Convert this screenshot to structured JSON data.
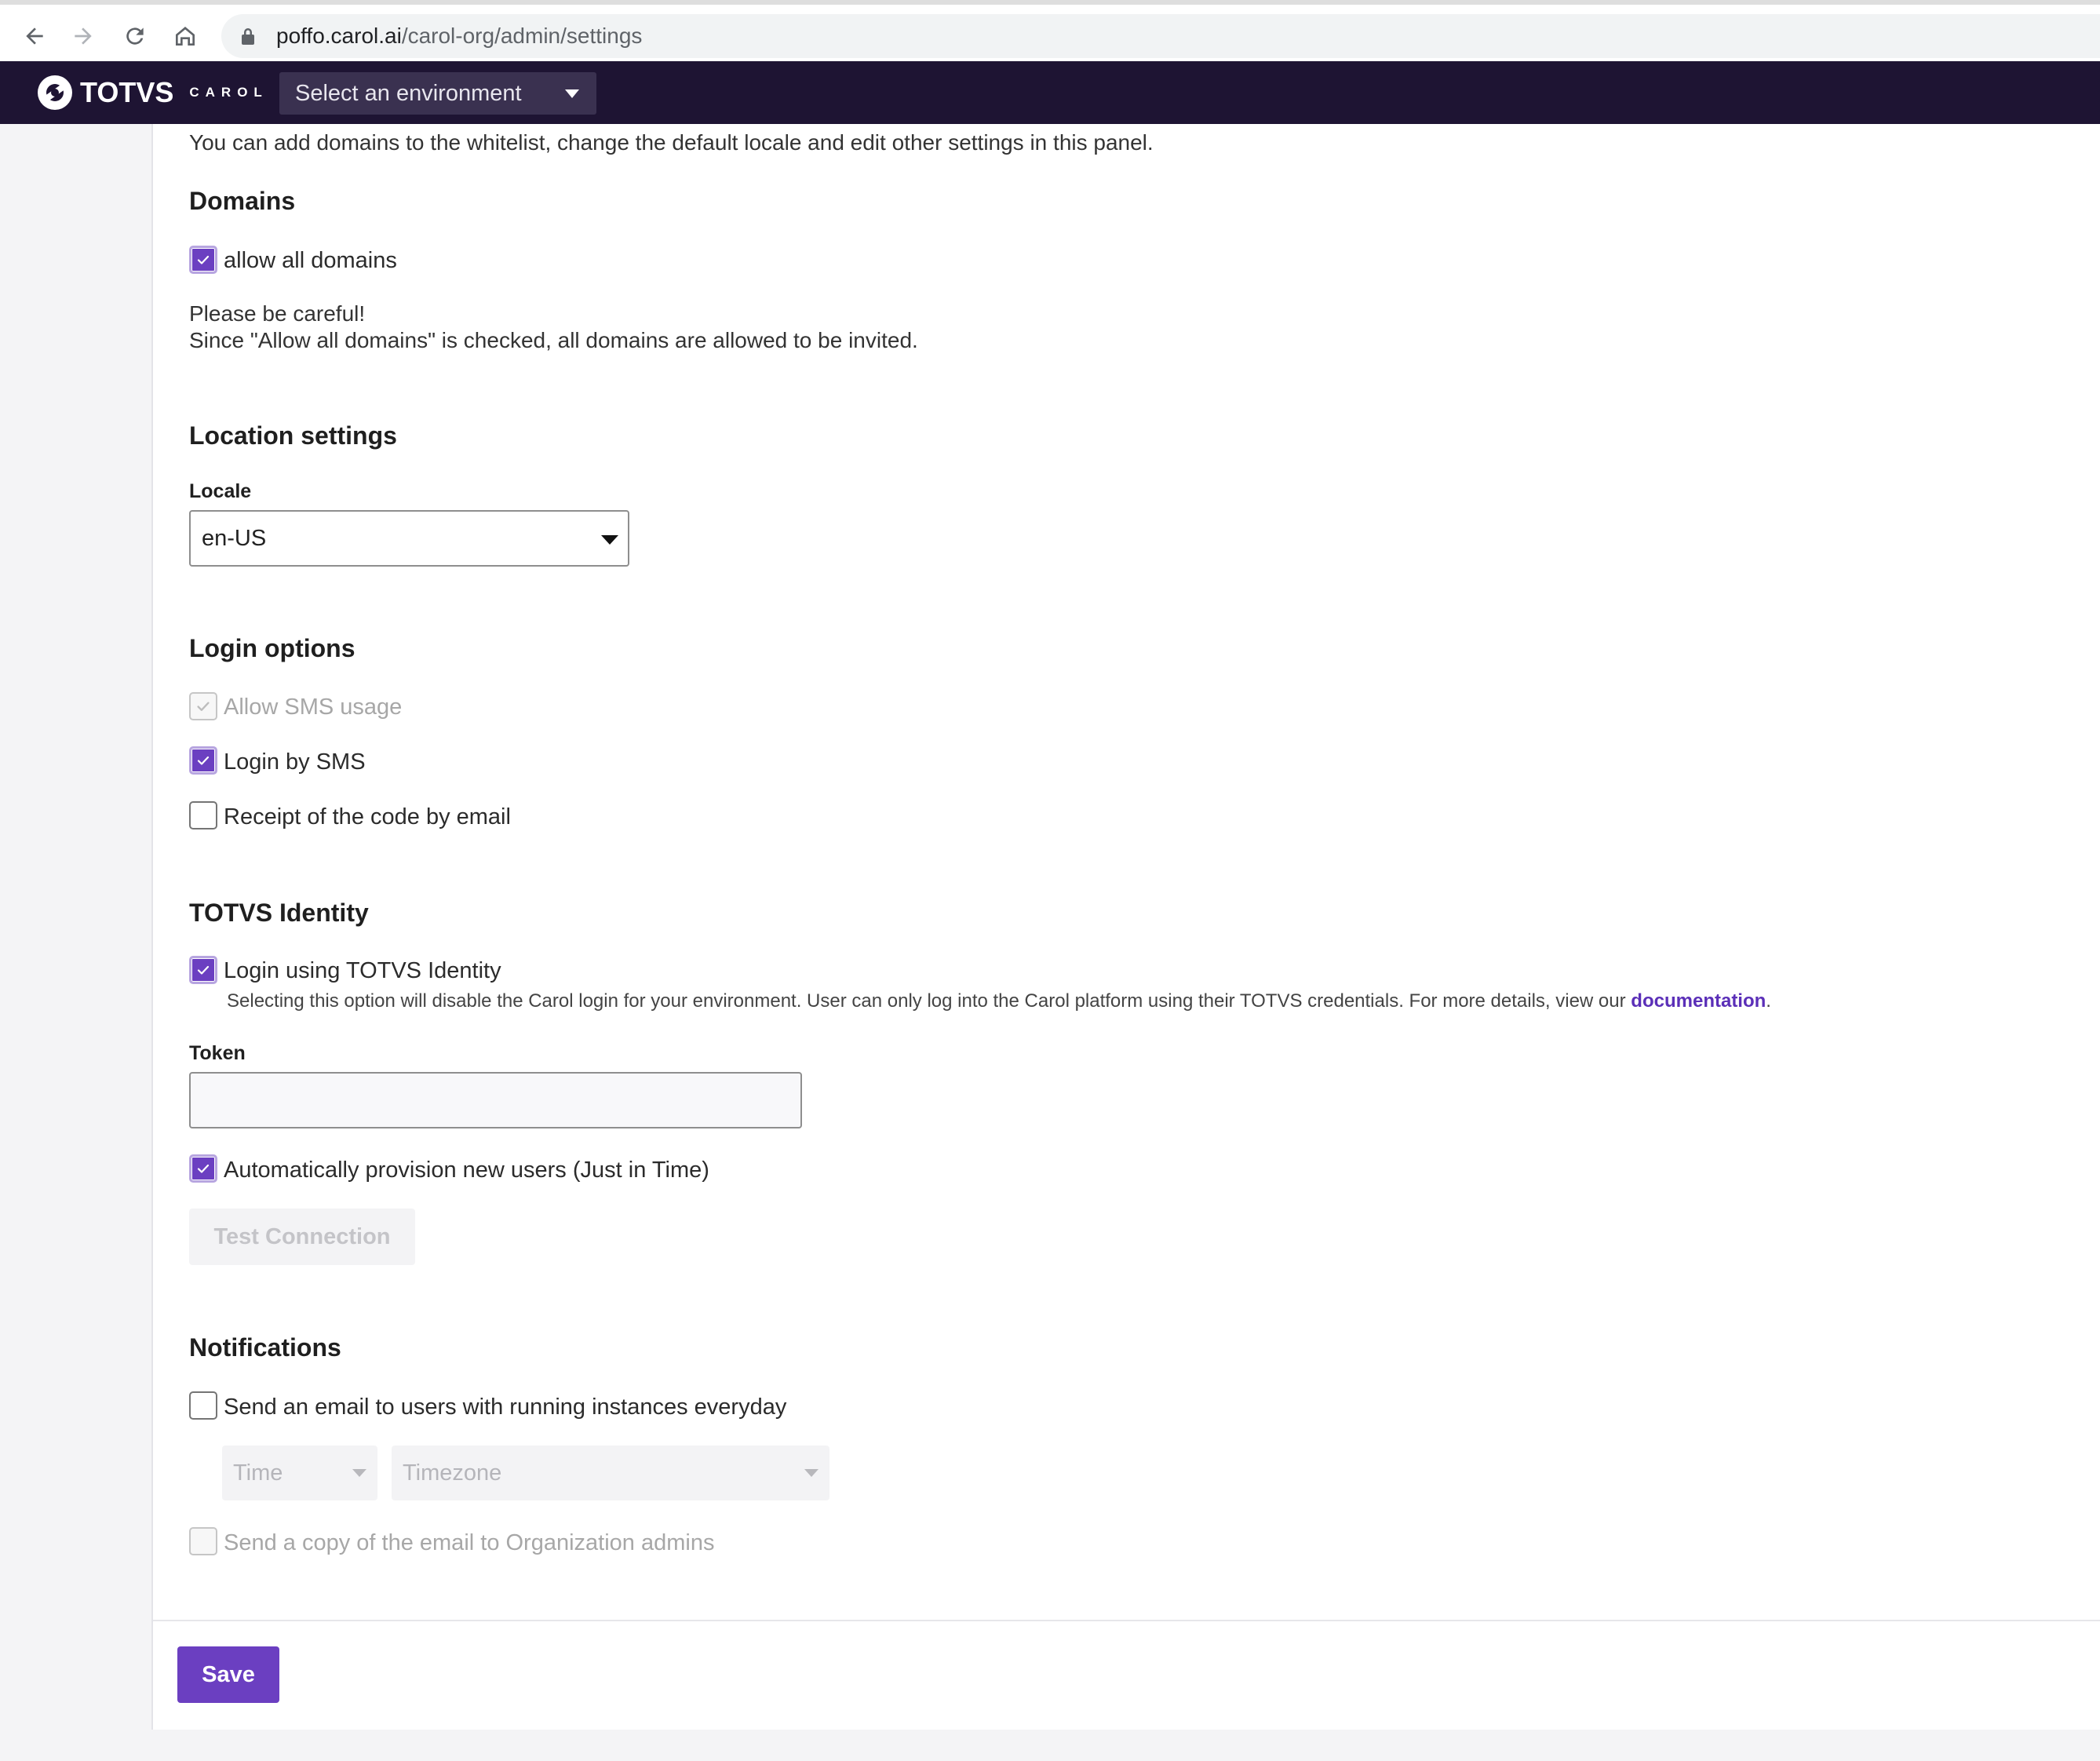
{
  "browser": {
    "url_domain": "poffo.carol.ai",
    "url_path": "/carol-org/admin/settings"
  },
  "header": {
    "logo_text": "TOTVS",
    "logo_subtext": "CAROL",
    "environment_select": "Select an environment",
    "brand_color": "#1e1433"
  },
  "intro": "You can add domains to the whitelist, change the default locale and edit other settings in this panel.",
  "domains": {
    "title": "Domains",
    "allow_all": {
      "label": "allow all domains",
      "checked": true
    },
    "warning_line1": "Please be careful!",
    "warning_line2": "Since \"Allow all domains\" is checked, all domains are allowed to be invited."
  },
  "location": {
    "title": "Location settings",
    "locale_label": "Locale",
    "locale_value": "en-US"
  },
  "login": {
    "title": "Login options",
    "allow_sms": {
      "label": "Allow SMS usage",
      "checked": true,
      "disabled": true
    },
    "login_sms": {
      "label": "Login by SMS",
      "checked": true
    },
    "receipt_email": {
      "label": "Receipt of the code by email",
      "checked": false
    }
  },
  "identity": {
    "title": "TOTVS Identity",
    "login_identity": {
      "label": "Login using TOTVS Identity",
      "checked": true
    },
    "help_text": "Selecting this option will disable the Carol login for your environment. User can only log into the Carol platform using their TOTVS credentials. For more details, view our ",
    "doc_link": "documentation",
    "help_end": ".",
    "token_label": "Token",
    "token_value": "",
    "auto_provision": {
      "label": "Automatically provision new users (Just in Time)",
      "checked": true
    },
    "test_button": "Test Connection"
  },
  "notifications": {
    "title": "Notifications",
    "send_email": {
      "label": "Send an email to users with running instances everyday",
      "checked": false
    },
    "time_placeholder": "Time",
    "timezone_placeholder": "Timezone",
    "send_copy": {
      "label": "Send a copy of the email to Organization admins",
      "checked": false
    }
  },
  "footer": {
    "save": "Save",
    "accent_color": "#6b3fc1"
  }
}
